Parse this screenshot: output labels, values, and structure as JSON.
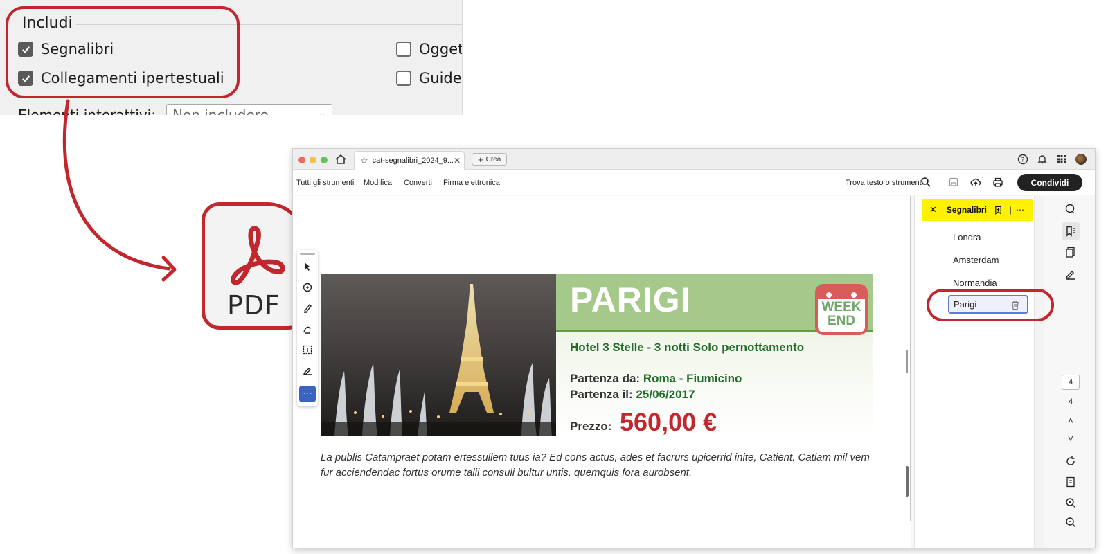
{
  "export_dialog": {
    "group_title": "Includi",
    "options": [
      {
        "label": "Segnalibri",
        "checked": true
      },
      {
        "label": "Collegamenti ipertestuali",
        "checked": true
      },
      {
        "label": "Oggetti",
        "checked": false
      },
      {
        "label": "Guide",
        "checked": false
      }
    ],
    "interactive_label": "Elementi interattivi:",
    "interactive_value": "Non includere"
  },
  "pdf_icon": {
    "label": "PDF"
  },
  "acrobat": {
    "tab_title": "cat-segnalibri_2024_9...",
    "new_tab_label": "Crea",
    "menu": [
      "Tutti gli strumenti",
      "Modifica",
      "Converti",
      "Firma elettronica"
    ],
    "search_label": "Trova testo o strumenti",
    "share_label": "Condividi",
    "document": {
      "city": "PARIGI",
      "badge_line1": "WEEK",
      "badge_line2": "END",
      "hotel": "Hotel 3 Stelle - 3 notti Solo pernottamento",
      "departure_from_label": "Partenza da:",
      "departure_from_value": "Roma - Fiumicino",
      "departure_date_label": "Partenza il:",
      "departure_date_value": "25/06/2017",
      "price_label": "Prezzo:",
      "price_value": "560,00 €",
      "body_text": "La publis Catampraet potam ertessullem tuus ia? Ed cons actus, ades et facrurs upicerrid inite, Catient. Catiam mil vem fur acciendendac fortus orume talii consuli bultur untis, quemquis fora aurobsent."
    },
    "bookmarks_panel": {
      "title": "Segnalibri",
      "items": [
        "Londra",
        "Amsterdam",
        "Normandia",
        "Parigi"
      ],
      "selected": "Parigi"
    },
    "page_current": "4",
    "page_total": "4"
  },
  "colors": {
    "accent_red": "#c1272d",
    "highlight_yellow": "#fff200",
    "green": "#236b2a"
  }
}
